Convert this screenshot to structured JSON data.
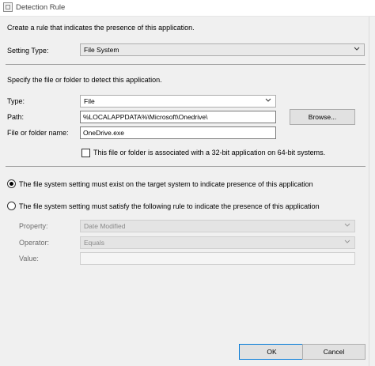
{
  "window": {
    "title": "Detection Rule",
    "icon": "app-window-icon"
  },
  "intro": "Create a rule that indicates the presence of this application.",
  "setting_type": {
    "label": "Setting Type:",
    "value": "File System"
  },
  "detect_section": {
    "heading": "Specify the file or folder to detect this application.",
    "type_label": "Type:",
    "type_value": "File",
    "path_label": "Path:",
    "path_value": "%LOCALAPPDATA%\\Microsoft\\Onedrive\\",
    "browse_label": "Browse...",
    "name_label": "File or folder name:",
    "name_value": "OneDrive.exe",
    "checkbox_label": "This file or folder is associated with a 32-bit application on 64-bit systems.",
    "checkbox_checked": false
  },
  "options": {
    "exist_label": "The file system setting must exist on the target system to indicate presence of this application",
    "exist_selected": true,
    "rule_label": "The file system setting must satisfy the following rule to indicate the presence of this application",
    "rule_selected": false
  },
  "rule": {
    "property_label": "Property:",
    "property_value": "Date Modified",
    "operator_label": "Operator:",
    "operator_value": "Equals",
    "value_label": "Value:",
    "value_value": ""
  },
  "footer": {
    "ok_label": "OK",
    "cancel_label": "Cancel"
  }
}
